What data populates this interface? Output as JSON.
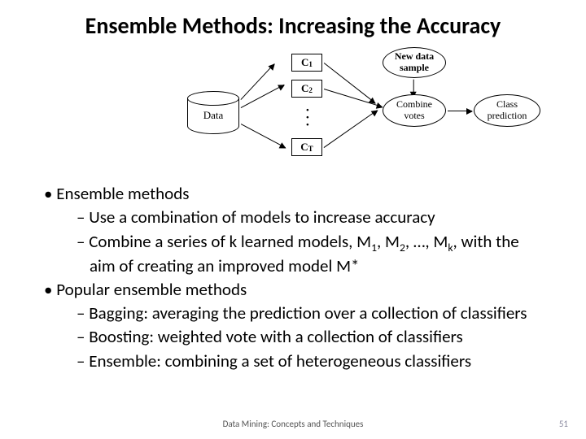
{
  "title": "Ensemble Methods: Increasing the Accuracy",
  "diagram": {
    "data_label": "Data",
    "classifiers": {
      "c1": "1",
      "c2": "2",
      "cT": "T",
      "c_prefix": "C"
    },
    "combine": "Combine\nvotes",
    "newdata": "New data\nsample",
    "prediction": "Class\nprediction"
  },
  "bullets": {
    "b1": "Ensemble methods",
    "b1a": "Use a combination of models to increase accuracy",
    "b1b_pre": "Combine a series of k learned models, M",
    "b1b_m1": "1",
    "b1b_mid1": ", M",
    "b1b_m2": "2",
    "b1b_mid2": ", …, M",
    "b1b_mk": "k",
    "b1b_post": ", with the aim of creating an improved model M*",
    "b2": "Popular ensemble methods",
    "b2a": "Bagging: averaging the prediction over a collection of classifiers",
    "b2b": "Boosting: weighted vote with a collection of classifiers",
    "b2c": "Ensemble: combining a set of heterogeneous classifiers"
  },
  "footer": "Data Mining: Concepts and Techniques",
  "page": "51"
}
